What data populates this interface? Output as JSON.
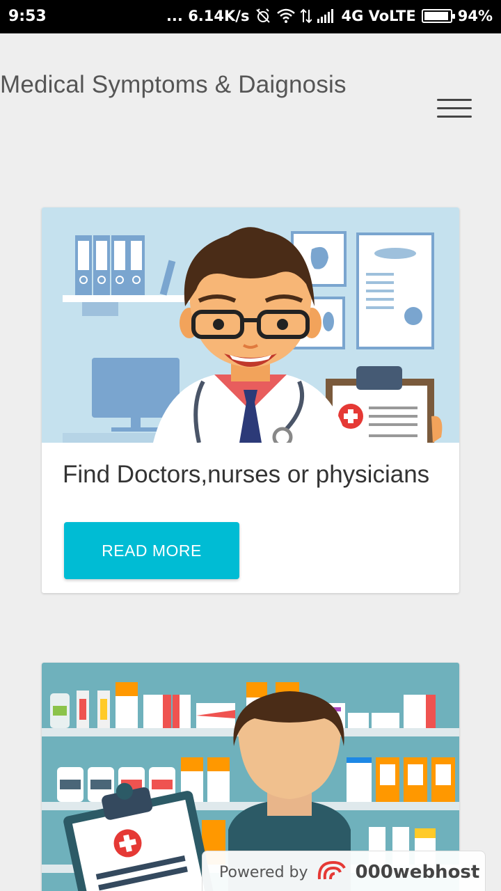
{
  "status_bar": {
    "time": "9:53",
    "network_speed": "... 6.14K/s",
    "network_label": "4G VoLTE",
    "battery_percent": "94%",
    "battery_level": 0.94
  },
  "header": {
    "title": "Medical Symptoms & Daignosis"
  },
  "cards": [
    {
      "title": "Find Doctors,nurses or physicians",
      "button_label": "READ MORE"
    }
  ],
  "badge": {
    "powered_by": "Powered by",
    "brand": "000webhost"
  },
  "colors": {
    "accent": "#00bcd4",
    "background": "#eeeeee"
  }
}
